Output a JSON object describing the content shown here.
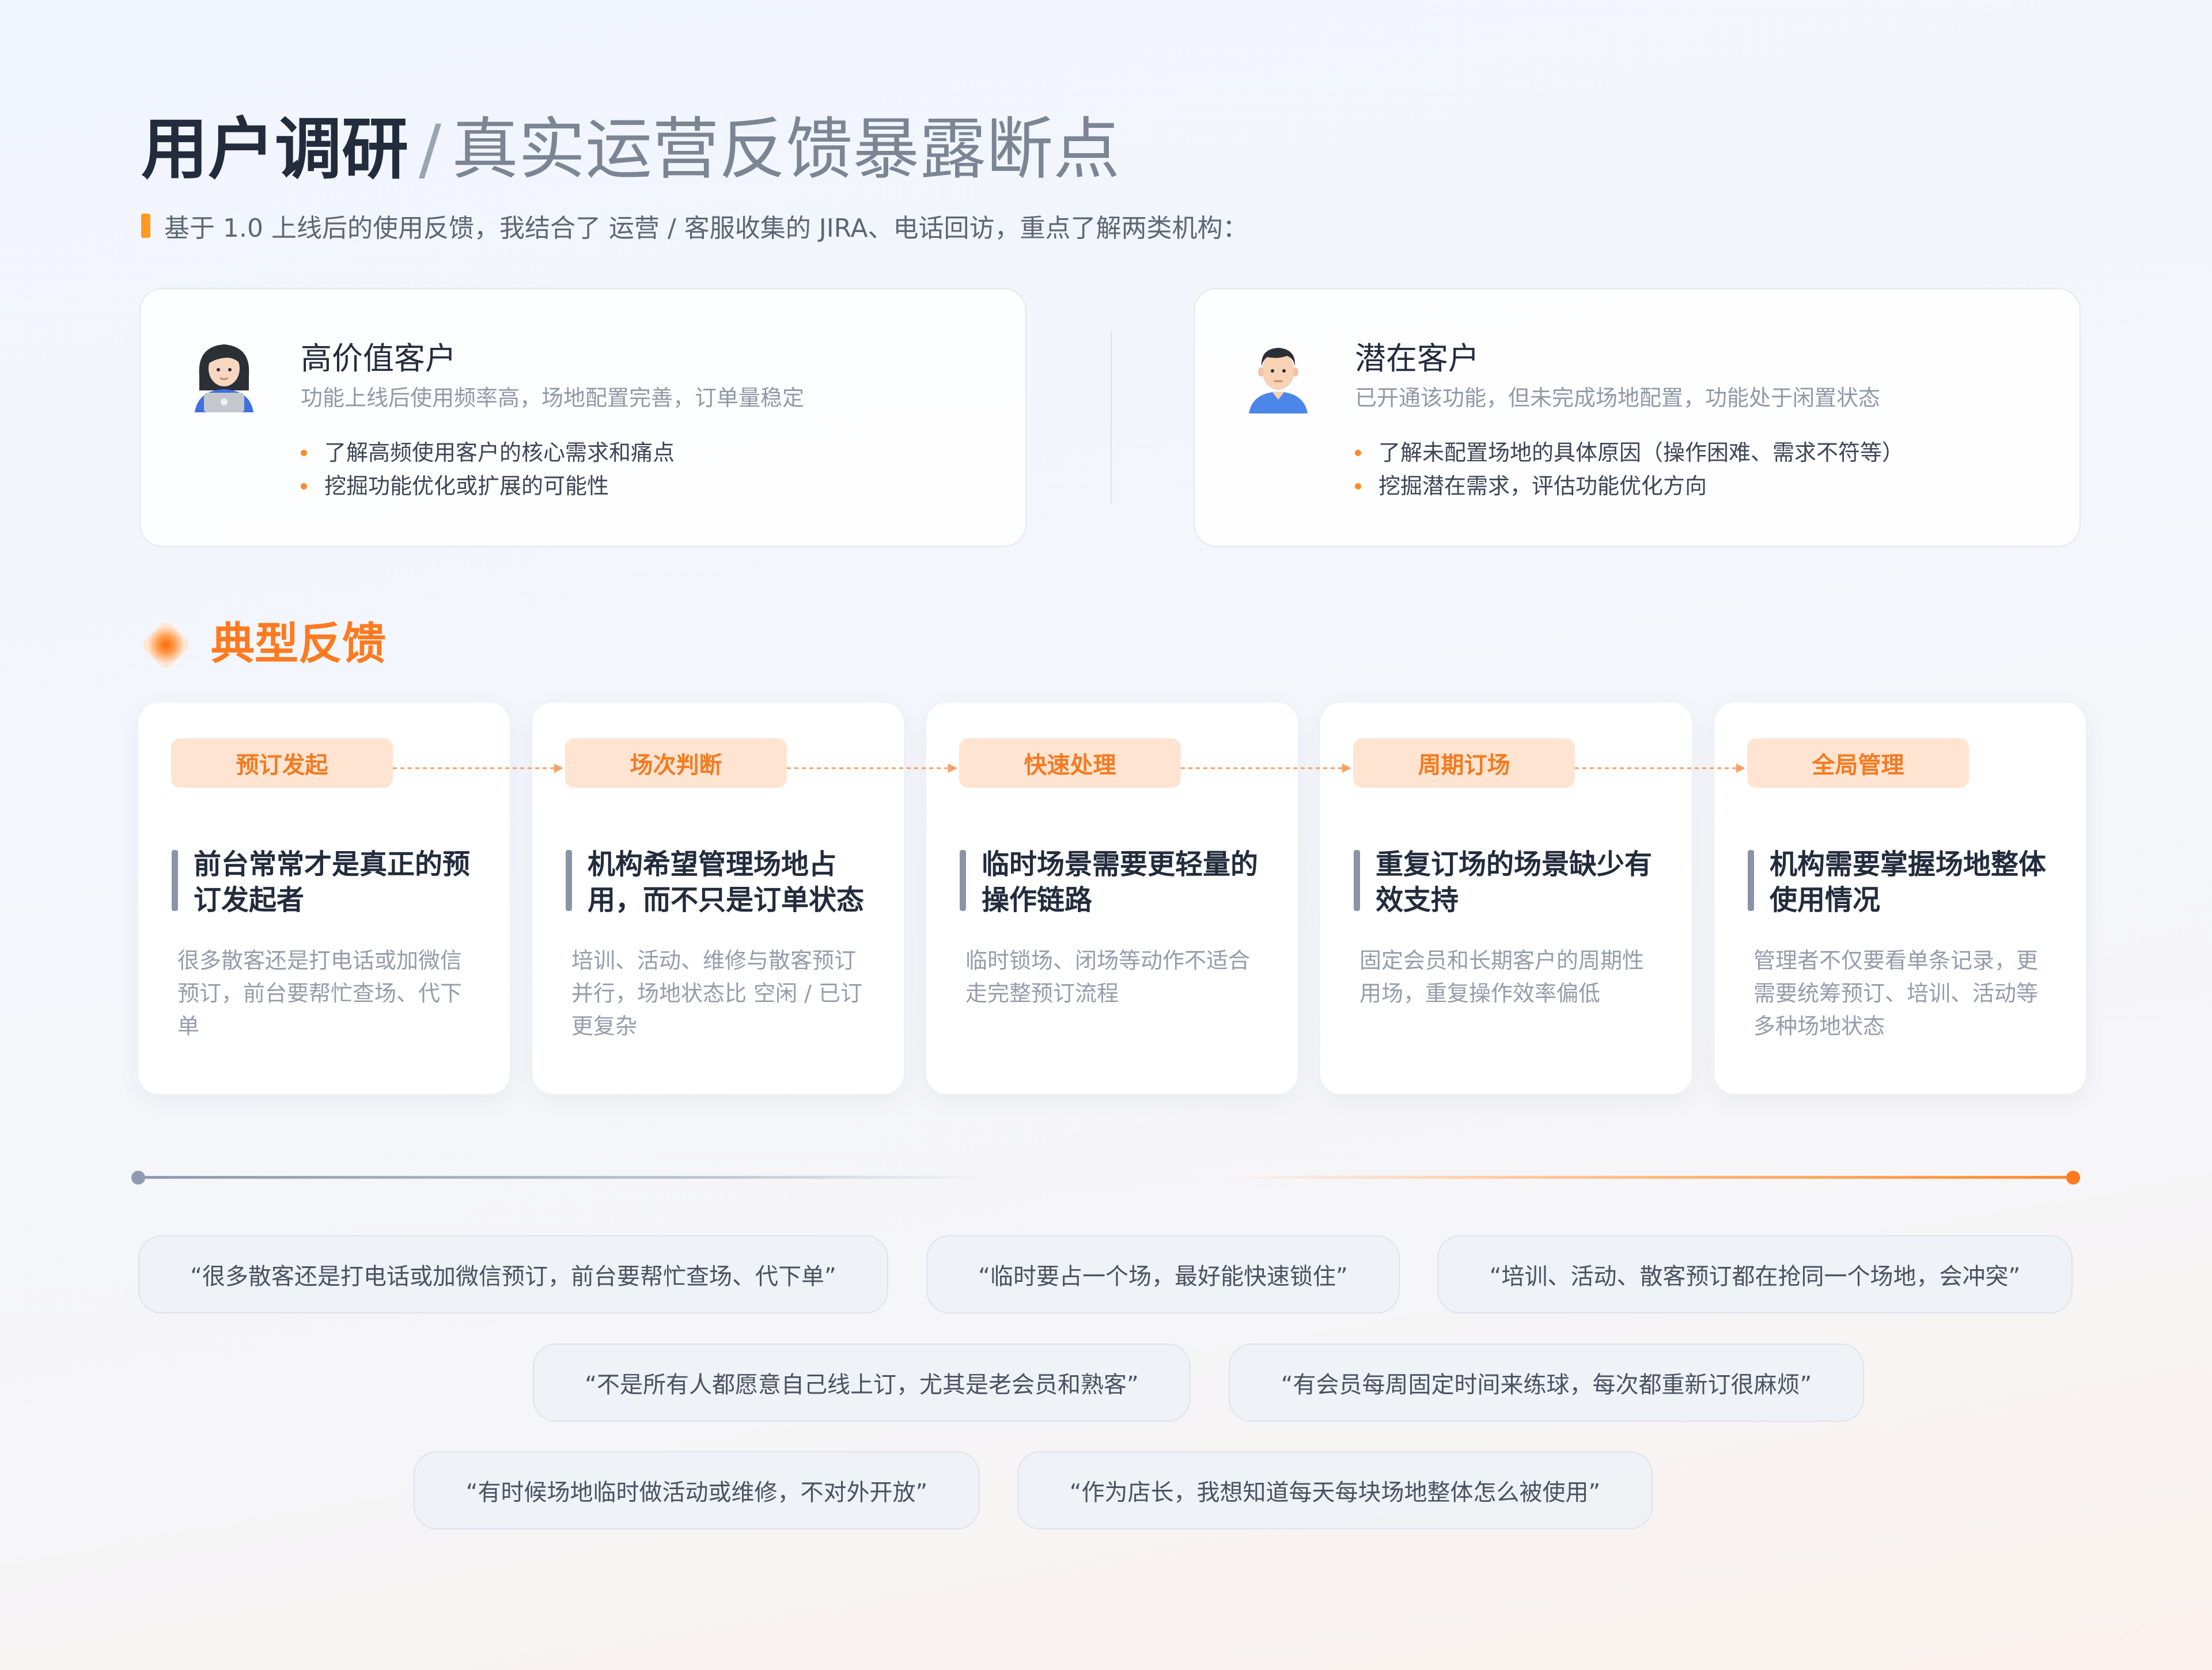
{
  "header": {
    "title_main": "用户调研",
    "title_slash": "/",
    "title_sub": "真实运营反馈暴露断点",
    "subtitle": "基于 1.0 上线后的使用反馈，我结合了 运营 / 客服收集的 JIRA、电话回访，重点了解两类机构："
  },
  "segments": [
    {
      "title": "高价值客户",
      "desc": "功能上线后使用频率高，场地配置完善，订单量稳定",
      "points": [
        "了解高频使用客户的核心需求和痛点",
        "挖掘功能优化或扩展的可能性"
      ]
    },
    {
      "title": "潜在客户",
      "desc": "已开通该功能，但未完成场地配置，功能处于闲置状态",
      "points": [
        "了解未配置场地的具体原因（操作困难、需求不符等）",
        "挖掘潜在需求，评估功能优化方向"
      ]
    }
  ],
  "section": {
    "title": "典型反馈"
  },
  "feedback": [
    {
      "tag": "预订发起",
      "title": "前台常常才是真正的预订发起者",
      "desc": "很多散客还是打电话或加微信预订，前台要帮忙查场、代下单"
    },
    {
      "tag": "场次判断",
      "title": "机构希望管理场地占用，而不只是订单状态",
      "desc": "培训、活动、维修与散客预订并行，场地状态比 空闲 / 已订 更复杂"
    },
    {
      "tag": "快速处理",
      "title": "临时场景需要更轻量的操作链路",
      "desc": "临时锁场、闭场等动作不适合走完整预订流程"
    },
    {
      "tag": "周期订场",
      "title": "重复订场的场景缺少有效支持",
      "desc": "固定会员和长期客户的周期性用场，重复操作效率偏低"
    },
    {
      "tag": "全局管理",
      "title": "机构需要掌握场地整体使用情况",
      "desc": "管理者不仅要看单条记录，更需要统筹预订、培训、活动等多种场地状态"
    }
  ],
  "quotes": [
    "“很多散客还是打电话或加微信预订，前台要帮忙查场、代下单”",
    "“临时要占一个场，最好能快速锁住”",
    "“培训、活动、散客预订都在抢同一个场地，会冲突”",
    "“不是所有人都愿意自己线上订，尤其是老会员和熟客”",
    "“有会员每周固定时间来练球，每次都重新订很麻烦”",
    "“有时候场地临时做活动或维修，不对外开放”",
    "“作为店长，我想知道每天每块场地整体怎么被使用”"
  ],
  "colors": {
    "accent": "#ff7a1f",
    "tag_bg": "#ffe4d2",
    "title_dark": "#232c3d",
    "muted": "#959caa"
  }
}
